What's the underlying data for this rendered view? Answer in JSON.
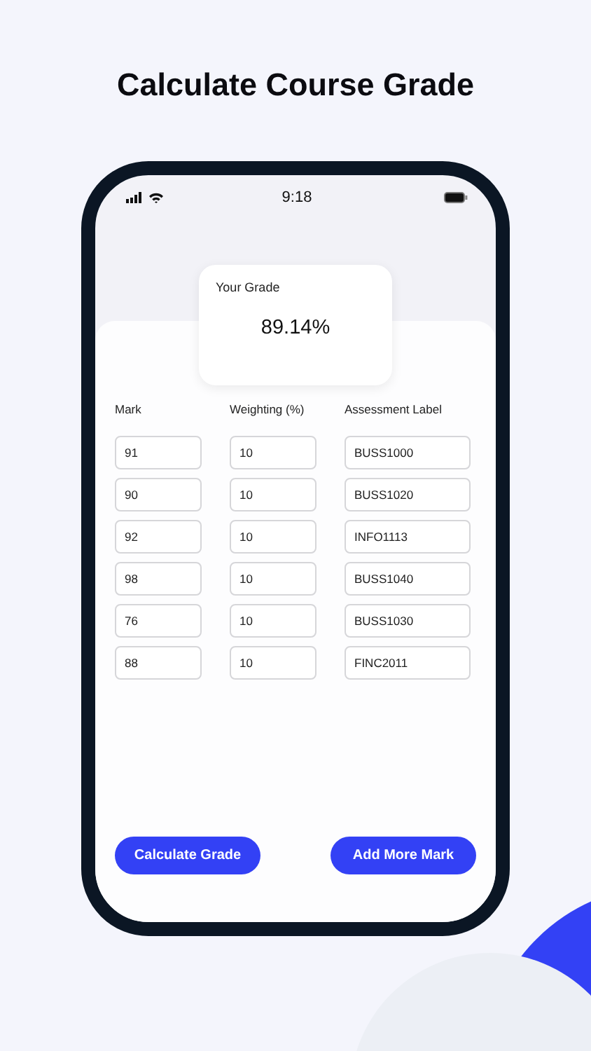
{
  "headline": "Calculate Course Grade",
  "status_bar": {
    "time": "9:18"
  },
  "grade_card": {
    "label": "Your Grade",
    "value": "89.14%"
  },
  "columns": [
    "Mark",
    "Weighting (%)",
    "Assessment Label"
  ],
  "rows": [
    {
      "mark": "91",
      "weighting": "10",
      "label": "BUSS1000"
    },
    {
      "mark": "90",
      "weighting": "10",
      "label": "BUSS1020"
    },
    {
      "mark": "92",
      "weighting": "10",
      "label": "INFO1113"
    },
    {
      "mark": "98",
      "weighting": "10",
      "label": "BUSS1040"
    },
    {
      "mark": "76",
      "weighting": "10",
      "label": "BUSS1030"
    },
    {
      "mark": "88",
      "weighting": "10",
      "label": "FINC2011"
    }
  ],
  "buttons": [
    "Calculate Grade",
    "Add More Mark"
  ]
}
